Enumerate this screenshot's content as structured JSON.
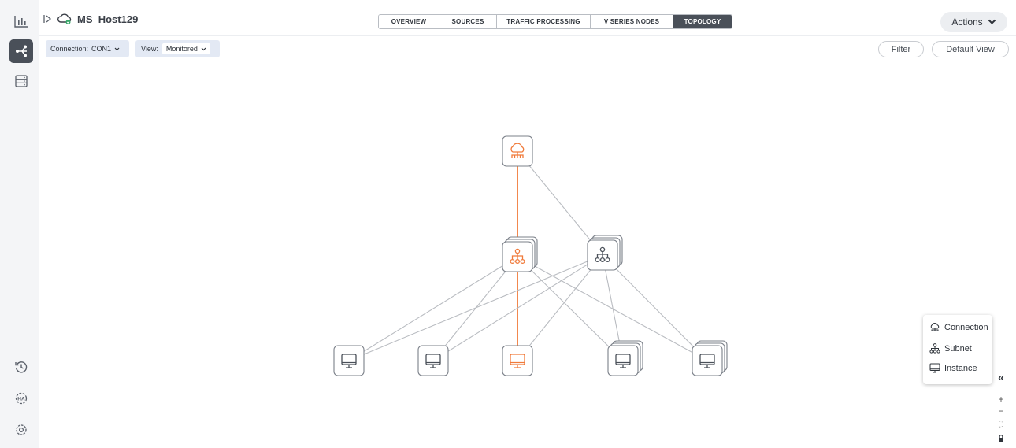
{
  "host": {
    "name": "MS_Host129"
  },
  "tabs": [
    {
      "label": "OVERVIEW",
      "active": false
    },
    {
      "label": "SOURCES",
      "active": false
    },
    {
      "label": "TRAFFIC PROCESSING",
      "active": false
    },
    {
      "label": "V SERIES NODES",
      "active": false
    },
    {
      "label": "TOPOLOGY",
      "active": true
    }
  ],
  "actions": {
    "label": "Actions"
  },
  "toolbar": {
    "connection_label": "Connection:",
    "connection_value": "CON1",
    "view_label": "View:",
    "view_value": "Monitored",
    "filter_label": "Filter",
    "default_view_label": "Default View"
  },
  "sidebar": {
    "items": [
      {
        "icon": "chart-icon",
        "active": false
      },
      {
        "icon": "topology-icon",
        "active": true
      },
      {
        "icon": "server-icon",
        "active": false
      },
      {
        "icon": "history-icon",
        "active": false
      },
      {
        "icon": "ha-gear-icon",
        "active": false
      },
      {
        "icon": "settings-icon",
        "active": false
      }
    ]
  },
  "legend": {
    "items": [
      {
        "label": "Connection",
        "icon": "connection-icon"
      },
      {
        "label": "Subnet",
        "icon": "subnet-icon"
      },
      {
        "label": "Instance",
        "icon": "instance-icon"
      }
    ]
  },
  "colors": {
    "highlight": "#f07a3a",
    "edge": "#b9bcc1",
    "accent_dark": "#4a5059"
  },
  "topology": {
    "nodes": [
      {
        "id": "connection",
        "type": "connection",
        "highlighted": true,
        "stacked": false
      },
      {
        "id": "subnet-1",
        "type": "subnet",
        "highlighted": true,
        "stacked": true
      },
      {
        "id": "subnet-2",
        "type": "subnet",
        "highlighted": false,
        "stacked": true
      },
      {
        "id": "instance-1",
        "type": "instance",
        "highlighted": false,
        "stacked": false
      },
      {
        "id": "instance-2",
        "type": "instance",
        "highlighted": false,
        "stacked": false
      },
      {
        "id": "instance-3",
        "type": "instance",
        "highlighted": true,
        "stacked": false
      },
      {
        "id": "instance-4",
        "type": "instance",
        "highlighted": false,
        "stacked": true
      },
      {
        "id": "instance-5",
        "type": "instance",
        "highlighted": false,
        "stacked": true
      }
    ],
    "edges": [
      {
        "from": "connection",
        "to": "subnet-1",
        "highlighted": true
      },
      {
        "from": "connection",
        "to": "subnet-2",
        "highlighted": false
      },
      {
        "from": "subnet-1",
        "to": "instance-2",
        "highlighted": false
      },
      {
        "from": "subnet-1",
        "to": "instance-3",
        "highlighted": true
      },
      {
        "from": "subnet-1",
        "to": "instance-4",
        "highlighted": false
      },
      {
        "from": "subnet-1",
        "to": "instance-5",
        "highlighted": false
      },
      {
        "from": "subnet-1",
        "to": "instance-1",
        "highlighted": false
      },
      {
        "from": "subnet-2",
        "to": "instance-1",
        "highlighted": false
      },
      {
        "from": "subnet-2",
        "to": "instance-2",
        "highlighted": false
      },
      {
        "from": "subnet-2",
        "to": "instance-3",
        "highlighted": false
      },
      {
        "from": "subnet-2",
        "to": "instance-4",
        "highlighted": false
      },
      {
        "from": "subnet-2",
        "to": "instance-5",
        "highlighted": false
      }
    ]
  }
}
